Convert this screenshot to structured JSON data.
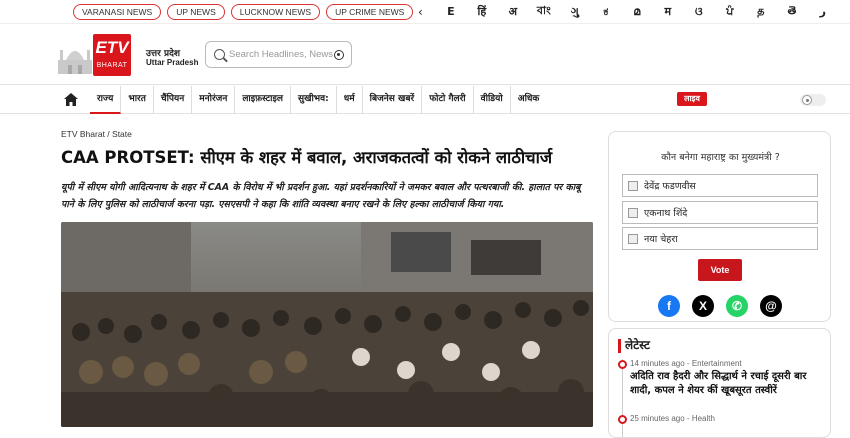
{
  "top_bar": {
    "cities": [
      "VARANASI NEWS",
      "UP NEWS",
      "LUCKNOW NEWS",
      "UP CRIME NEWS"
    ],
    "languages": [
      "E",
      "हिं",
      "अ",
      "বাং",
      "ગુ",
      "ಕ",
      "മ",
      "म",
      "ଓ",
      "ਪੰ",
      "த",
      "తె",
      "ر"
    ]
  },
  "header": {
    "logo_text": "ETV",
    "logo_subtext": "BHARAT",
    "state_hindi": "उत्तर प्रदेश",
    "state_english": "Uttar Pradesh",
    "search_placeholder": "Search Headlines, News..."
  },
  "nav": {
    "items": [
      "राज्य",
      "भारत",
      "चैंपियन",
      "मनोरंजन",
      "लाइफ़स्टाइल",
      "सुखीभव:",
      "धर्म",
      "बिजनेस खबरें",
      "फोटो गैलरी",
      "वीडियो",
      "अधिक"
    ],
    "active_index": 0,
    "live_label": "लाइव"
  },
  "article": {
    "breadcrumb": "ETV Bharat / State",
    "headline": "CAA PROTSET: सीएम के शहर में बवाल, अराजकतत्वों को रोकने लाठीचार्ज",
    "summary": "यूपी में सीएम योगी आदित्यनाथ के शहर में CAA के विरोध में भी प्रदर्शन हुआ. यहां प्रदर्शनकारियों ने जमकर बवाल और पत्थरबाजी की. हालात पर काबू पाने के लिए पुलिस को लाठीचार्ज करना पड़ा. एसएसपी ने कहा कि शांति व्यवस्था बनाए रखने के लिए हल्का लाठीचार्ज किया गया."
  },
  "poll": {
    "question": "कौन बनेगा महाराष्ट्र का मुख्यमंत्री ?",
    "options": [
      "देवेंद्र फडणवीस",
      "एकनाथ शिंदे",
      "नया चेहरा"
    ],
    "vote_label": "Vote"
  },
  "latest": {
    "title": "लेटेस्ट",
    "items": [
      {
        "meta": "14 minutes ago - Entertainment",
        "title": "अदिति राव हैदरी और सिद्धार्थ ने रचाई दूसरी बार शादी, कपल ने शेयर कीं खूबसूरत तस्वीरें"
      },
      {
        "meta": "25 minutes ago - Health",
        "title": ""
      }
    ]
  },
  "colors": {
    "brand_red": "#d9161c",
    "facebook": "#1877f2",
    "whatsapp": "#25d366",
    "x": "#000000"
  },
  "icons": [
    "home-icon",
    "search-icon",
    "go-icon",
    "theme-toggle-icon",
    "facebook-icon",
    "x-icon",
    "whatsapp-icon",
    "threads-icon"
  ]
}
